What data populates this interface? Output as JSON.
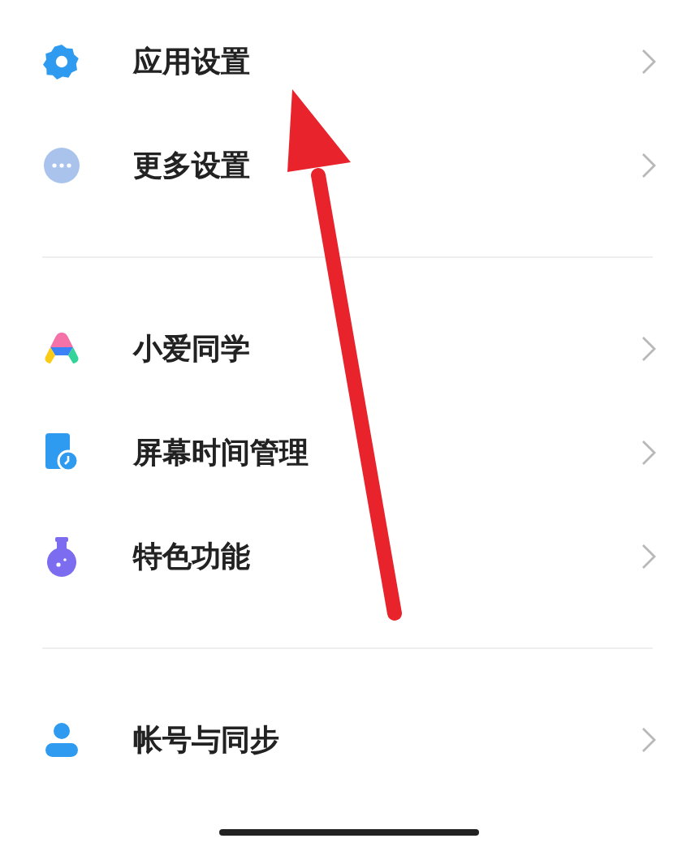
{
  "sections": [
    {
      "items": [
        {
          "kind": "gear",
          "label": "应用设置"
        },
        {
          "kind": "dots",
          "label": "更多设置"
        }
      ]
    },
    {
      "items": [
        {
          "kind": "assistant",
          "label": "小爱同学"
        },
        {
          "kind": "screen-time",
          "label": "屏幕时间管理"
        },
        {
          "kind": "flask",
          "label": "特色功能"
        }
      ]
    },
    {
      "items": [
        {
          "kind": "person",
          "label": "帐号与同步"
        }
      ]
    }
  ]
}
